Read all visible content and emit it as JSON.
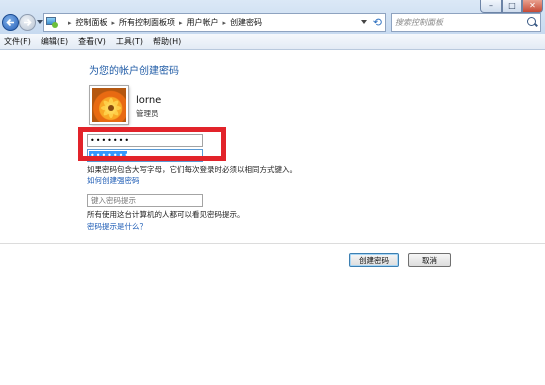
{
  "window": {
    "min_glyph": "–",
    "max_glyph": "□",
    "close_glyph": "✕"
  },
  "address": {
    "breadcrumbs": [
      "控制面板",
      "所有控制面板项",
      "用户帐户",
      "创建密码"
    ],
    "separator": "▸"
  },
  "search": {
    "placeholder": "搜索控制面板"
  },
  "menu": {
    "items": [
      "文件(F)",
      "编辑(E)",
      "查看(V)",
      "工具(T)",
      "帮助(H)"
    ]
  },
  "main": {
    "title": "为您的帐户创建密码",
    "user": {
      "name": "lorne",
      "role": "管理员"
    },
    "password_value": "•••••••",
    "confirm_value": "•••••••",
    "password_hint_text": "如果密码包含大写字母，它们每次登录时必须以相同方式键入。",
    "how_to_link": "如何创建强密码",
    "hint_placeholder": "键入密码提示",
    "hint_note": "所有使用这台计算机的人都可以看见密码提示。",
    "hint_link": "密码提示是什么？",
    "create_button": "创建密码",
    "cancel_button": "取消"
  },
  "colors": {
    "highlight_border": "#e2232a",
    "link": "#1c5bb5",
    "title": "#1e5aa5"
  }
}
